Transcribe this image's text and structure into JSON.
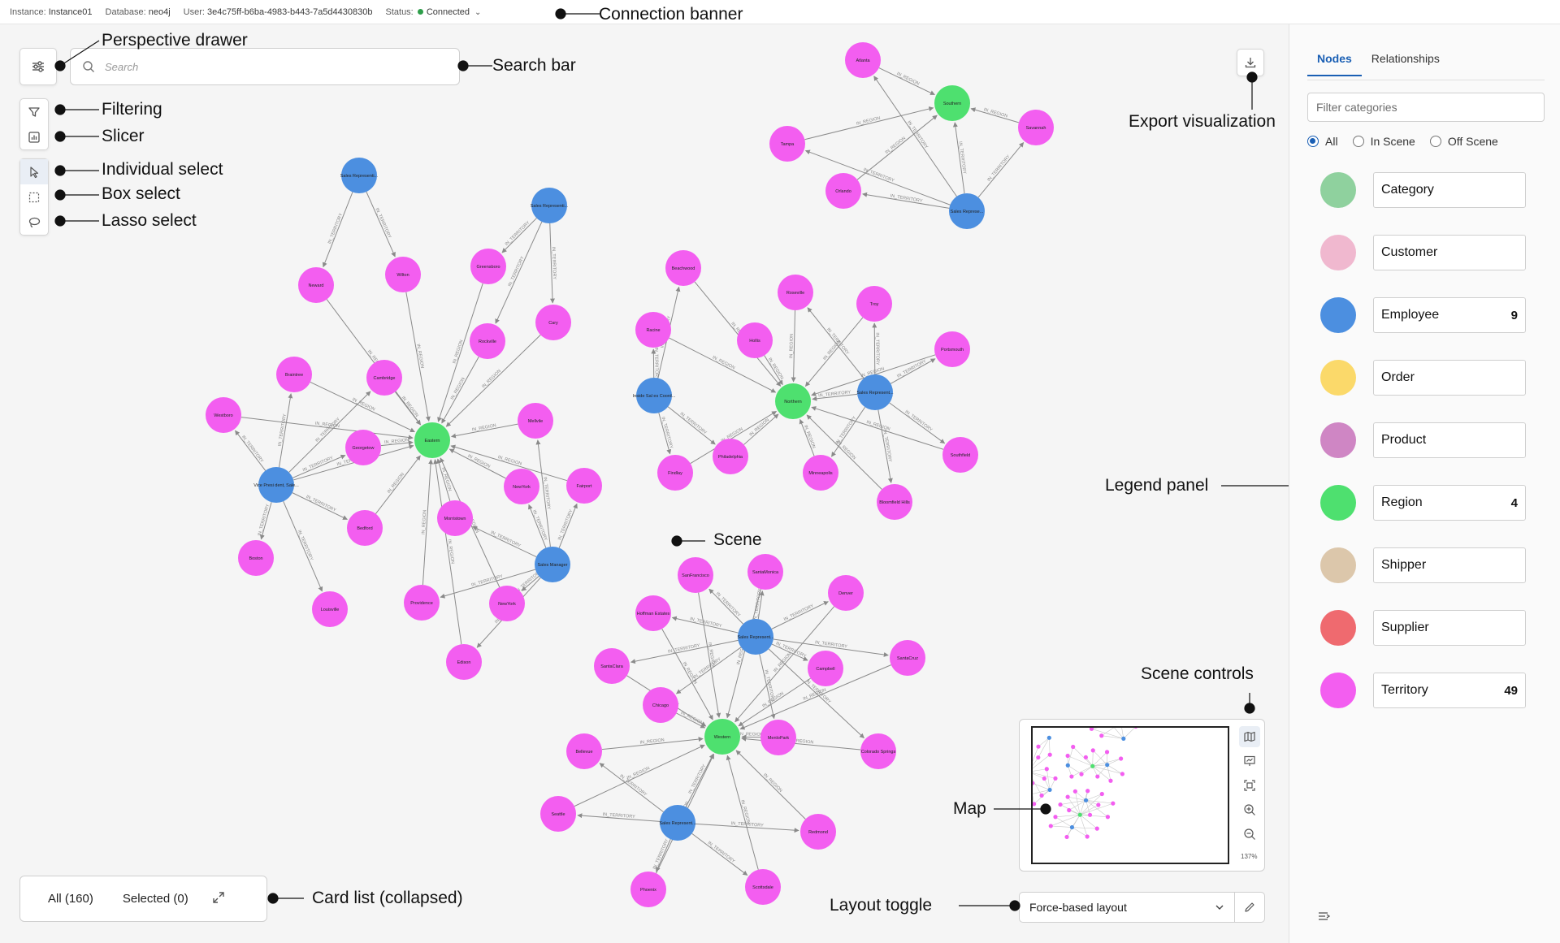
{
  "connection": {
    "instance_key": "Instance:",
    "instance_val": "Instance01",
    "database_key": "Database:",
    "database_val": "neo4j",
    "user_key": "User:",
    "user_val": "3e4c75ff-b6ba-4983-b443-7a5d4430830b",
    "status_key": "Status:",
    "status_val": "Connected",
    "status_color": "#2e9e4a"
  },
  "search": {
    "placeholder": "Search"
  },
  "callouts": {
    "connection_banner": "Connection banner",
    "perspective_drawer": "Perspective drawer",
    "search_bar": "Search bar",
    "filtering": "Filtering",
    "slicer": "Slicer",
    "individual_select": "Individual select",
    "box_select": "Box select",
    "lasso_select": "Lasso select",
    "export_visualization": "Export visualization",
    "legend_panel": "Legend panel",
    "scene": "Scene",
    "scene_controls": "Scene controls",
    "map": "Map",
    "card_list": "Card list (collapsed)",
    "layout_toggle": "Layout toggle"
  },
  "card_list": {
    "all": "All (160)",
    "selected": "Selected (0)"
  },
  "layout": {
    "selected": "Force-based layout"
  },
  "minimap": {
    "zoom": "137%"
  },
  "side_panel": {
    "tabs": [
      "Nodes",
      "Relationships"
    ],
    "filter_placeholder": "Filter categories",
    "radios": [
      "All",
      "In Scene",
      "Off Scene"
    ],
    "legend": [
      {
        "label": "Category",
        "count": "",
        "color": "#8fd19e"
      },
      {
        "label": "Customer",
        "count": "",
        "color": "#f0b8cf"
      },
      {
        "label": "Employee",
        "count": "9",
        "color": "#4c8fe0"
      },
      {
        "label": "Order",
        "count": "",
        "color": "#fbd96a"
      },
      {
        "label": "Product",
        "count": "",
        "color": "#cf86c4"
      },
      {
        "label": "Region",
        "count": "4",
        "color": "#4ee06f"
      },
      {
        "label": "Shipper",
        "count": "",
        "color": "#dcc7ab"
      },
      {
        "label": "Supplier",
        "count": "",
        "color": "#ef6a6f"
      },
      {
        "label": "Territory",
        "count": "49",
        "color": "#f35ef0"
      }
    ]
  },
  "colors": {
    "territory": "#f35ef0",
    "employee": "#4c8fe0",
    "region": "#4ee06f",
    "edge": "#8a8a8a"
  },
  "graph": {
    "nodes": [
      {
        "id": "eastern",
        "label": "Eastern",
        "type": "region"
      },
      {
        "id": "sr1",
        "label": "Sales Representi...",
        "type": "employee"
      },
      {
        "id": "zr1",
        "label": "Sales Representi...",
        "type": "employee"
      },
      {
        "id": "vp",
        "label": "Vice Presi dent, Sale...",
        "type": "employee"
      },
      {
        "id": "smgr",
        "label": "Sales Manager",
        "type": "employee"
      },
      {
        "id": "newark",
        "label": "Neward",
        "type": "territory"
      },
      {
        "id": "wilton",
        "label": "Wilton",
        "type": "territory"
      },
      {
        "id": "greensboro",
        "label": "Greensboro",
        "type": "territory"
      },
      {
        "id": "cary",
        "label": "Cary",
        "type": "territory"
      },
      {
        "id": "rockville",
        "label": "Rockville",
        "type": "territory"
      },
      {
        "id": "braintree",
        "label": "Braintree",
        "type": "territory"
      },
      {
        "id": "cambridge",
        "label": "Cambridge",
        "type": "territory"
      },
      {
        "id": "westboro",
        "label": "Westboro",
        "type": "territory"
      },
      {
        "id": "georgetow",
        "label": "Georgetow",
        "type": "territory"
      },
      {
        "id": "mellvile",
        "label": "Mellvile",
        "type": "territory"
      },
      {
        "id": "newyork1",
        "label": "NewYork",
        "type": "territory"
      },
      {
        "id": "fairport",
        "label": "Fairport",
        "type": "territory"
      },
      {
        "id": "bedford",
        "label": "Bedford",
        "type": "territory"
      },
      {
        "id": "morristown",
        "label": "Morristown",
        "type": "territory"
      },
      {
        "id": "boston",
        "label": "Boston",
        "type": "territory"
      },
      {
        "id": "louisville",
        "label": "Louisville",
        "type": "territory"
      },
      {
        "id": "providence",
        "label": "Providence",
        "type": "territory"
      },
      {
        "id": "newyork2",
        "label": "NewYork",
        "type": "territory"
      },
      {
        "id": "edison",
        "label": "Edison",
        "type": "territory"
      },
      {
        "id": "southern",
        "label": "Southern",
        "type": "region"
      },
      {
        "id": "atlanta",
        "label": "Atlanta",
        "type": "territory"
      },
      {
        "id": "savannah",
        "label": "Savannah",
        "type": "territory"
      },
      {
        "id": "tampa",
        "label": "Tampa",
        "type": "territory"
      },
      {
        "id": "orlando",
        "label": "Orlando",
        "type": "territory"
      },
      {
        "id": "sr2",
        "label": "Sales Represe...",
        "type": "employee"
      },
      {
        "id": "northern",
        "label": "Northern",
        "type": "region"
      },
      {
        "id": "beachwood",
        "label": "Beachwood",
        "type": "territory"
      },
      {
        "id": "roseville",
        "label": "Roseville",
        "type": "territory"
      },
      {
        "id": "troy",
        "label": "Troy",
        "type": "territory"
      },
      {
        "id": "racine",
        "label": "Racine",
        "type": "territory"
      },
      {
        "id": "hollis",
        "label": "Hollis",
        "type": "territory"
      },
      {
        "id": "portsmouth",
        "label": "Portsmouth",
        "type": "territory"
      },
      {
        "id": "isc",
        "label": "Inside Sal es Coord...",
        "type": "employee"
      },
      {
        "id": "sr3",
        "label": "Sales Represent...",
        "type": "employee"
      },
      {
        "id": "southfield",
        "label": "Southfield",
        "type": "territory"
      },
      {
        "id": "findlay",
        "label": "Findlay",
        "type": "territory"
      },
      {
        "id": "philadelphia",
        "label": "Philadelphia",
        "type": "territory"
      },
      {
        "id": "minneapolis",
        "label": "Minneapolis",
        "type": "territory"
      },
      {
        "id": "bloomfield",
        "label": "Bloomfield Hills",
        "type": "territory"
      },
      {
        "id": "western",
        "label": "Western",
        "type": "region"
      },
      {
        "id": "sanfran",
        "label": "SanFrancisco",
        "type": "territory"
      },
      {
        "id": "santamonica",
        "label": "SantaMonica",
        "type": "territory"
      },
      {
        "id": "denver",
        "label": "Denver",
        "type": "territory"
      },
      {
        "id": "hoffman",
        "label": "Hoffman Estates",
        "type": "territory"
      },
      {
        "id": "sr4",
        "label": "Sales Represent...",
        "type": "employee"
      },
      {
        "id": "santaclara",
        "label": "SantaClara",
        "type": "territory"
      },
      {
        "id": "campbell",
        "label": "Campbell",
        "type": "territory"
      },
      {
        "id": "santacruz",
        "label": "SantaCruz",
        "type": "territory"
      },
      {
        "id": "chicago",
        "label": "Chicago",
        "type": "territory"
      },
      {
        "id": "menlo",
        "label": "MenloPark",
        "type": "territory"
      },
      {
        "id": "bellevue",
        "label": "Bellevue",
        "type": "territory"
      },
      {
        "id": "colorado",
        "label": "Colorado Springs",
        "type": "territory"
      },
      {
        "id": "seattle",
        "label": "Seattle",
        "type": "territory"
      },
      {
        "id": "sr5",
        "label": "Sales Represent...",
        "type": "employee"
      },
      {
        "id": "redmond",
        "label": "Redmond",
        "type": "territory"
      },
      {
        "id": "phoenix",
        "label": "Phoenix",
        "type": "territory"
      },
      {
        "id": "scottsdale",
        "label": "Scottsdale",
        "type": "territory"
      }
    ],
    "edges": [
      {
        "from": "sr1",
        "to": "newark",
        "label": "IN_TERRITORY"
      },
      {
        "from": "sr1",
        "to": "wilton",
        "label": "IN_TERRITORY"
      },
      {
        "from": "zr1",
        "to": "greensboro",
        "label": "IN_TERRITORY"
      },
      {
        "from": "zr1",
        "to": "cary",
        "label": "IN_TERRITORY"
      },
      {
        "from": "zr1",
        "to": "rockville",
        "label": "IN_TERRITORY"
      },
      {
        "from": "newark",
        "to": "eastern",
        "label": "IN_REGION"
      },
      {
        "from": "wilton",
        "to": "eastern",
        "label": "IN_REGION"
      },
      {
        "from": "greensboro",
        "to": "eastern",
        "label": "IN_REGION"
      },
      {
        "from": "cary",
        "to": "eastern",
        "label": "IN_REGION"
      },
      {
        "from": "rockville",
        "to": "eastern",
        "label": "IN_REGION"
      },
      {
        "from": "braintree",
        "to": "eastern",
        "label": "IN_REGION"
      },
      {
        "from": "cambridge",
        "to": "eastern",
        "label": "IN_REGION"
      },
      {
        "from": "westboro",
        "to": "eastern",
        "label": "IN_REGION"
      },
      {
        "from": "georgetow",
        "to": "eastern",
        "label": "IN_REGION"
      },
      {
        "from": "mellvile",
        "to": "eastern",
        "label": "IN_REGION"
      },
      {
        "from": "newyork1",
        "to": "eastern",
        "label": "IN_REGION"
      },
      {
        "from": "fairport",
        "to": "eastern",
        "label": "IN_REGION"
      },
      {
        "from": "bedford",
        "to": "eastern",
        "label": "IN_REGION"
      },
      {
        "from": "morristown",
        "to": "eastern",
        "label": "IN_REGION"
      },
      {
        "from": "providence",
        "to": "eastern",
        "label": "IN_REGION"
      },
      {
        "from": "newyork2",
        "to": "eastern",
        "label": "IN_REGION"
      },
      {
        "from": "edison",
        "to": "eastern",
        "label": "IN_REGION"
      },
      {
        "from": "vp",
        "to": "braintree",
        "label": "IN_TERRITORY"
      },
      {
        "from": "vp",
        "to": "cambridge",
        "label": "IN_TERRITORY"
      },
      {
        "from": "vp",
        "to": "westboro",
        "label": "IN_TERRITORY"
      },
      {
        "from": "vp",
        "to": "georgetow",
        "label": "IN_TERRITORY"
      },
      {
        "from": "vp",
        "to": "bedford",
        "label": "IN_TERRITORY"
      },
      {
        "from": "vp",
        "to": "boston",
        "label": "IN_TERRITORY"
      },
      {
        "from": "vp",
        "to": "louisville",
        "label": "IN_TERRITORY"
      },
      {
        "from": "vp",
        "to": "eastern",
        "label": "IN_TERRITORY"
      },
      {
        "from": "smgr",
        "to": "newyork1",
        "label": "IN_TERRITORY"
      },
      {
        "from": "smgr",
        "to": "fairport",
        "label": "IN_TERRITORY"
      },
      {
        "from": "smgr",
        "to": "morristown",
        "label": "IN_TERRITORY"
      },
      {
        "from": "smgr",
        "to": "providence",
        "label": "IN_TERRITORY"
      },
      {
        "from": "smgr",
        "to": "newyork2",
        "label": "IN_TERRITORY"
      },
      {
        "from": "smgr",
        "to": "edison",
        "label": "IN_TERRITORY"
      },
      {
        "from": "smgr",
        "to": "mellvile",
        "label": "IN_TERRITORY"
      },
      {
        "from": "atlanta",
        "to": "southern",
        "label": "IN_REGION"
      },
      {
        "from": "savannah",
        "to": "southern",
        "label": "IN_REGION"
      },
      {
        "from": "tampa",
        "to": "southern",
        "label": "IN_REGION"
      },
      {
        "from": "orlando",
        "to": "southern",
        "label": "IN_REGION"
      },
      {
        "from": "sr2",
        "to": "atlanta",
        "label": "IN_TERRITORY"
      },
      {
        "from": "sr2",
        "to": "savannah",
        "label": "IN_TERRITORY"
      },
      {
        "from": "sr2",
        "to": "tampa",
        "label": "IN_TERRITORY"
      },
      {
        "from": "sr2",
        "to": "orlando",
        "label": "IN_TERRITORY"
      },
      {
        "from": "sr2",
        "to": "southern",
        "label": "IN_TERRITORY"
      },
      {
        "from": "beachwood",
        "to": "northern",
        "label": "IN_REGION"
      },
      {
        "from": "roseville",
        "to": "northern",
        "label": "IN_REGION"
      },
      {
        "from": "troy",
        "to": "northern",
        "label": "IN_REGION"
      },
      {
        "from": "racine",
        "to": "northern",
        "label": "IN_REGION"
      },
      {
        "from": "hollis",
        "to": "northern",
        "label": "IN_REGION"
      },
      {
        "from": "portsmouth",
        "to": "northern",
        "label": "IN_REGION"
      },
      {
        "from": "southfield",
        "to": "northern",
        "label": "IN_REGION"
      },
      {
        "from": "findlay",
        "to": "northern",
        "label": "IN_REGION"
      },
      {
        "from": "philadelphia",
        "to": "northern",
        "label": "IN_REGION"
      },
      {
        "from": "minneapolis",
        "to": "northern",
        "label": "IN_REGION"
      },
      {
        "from": "bloomfield",
        "to": "northern",
        "label": "IN_REGION"
      },
      {
        "from": "isc",
        "to": "beachwood",
        "label": "IN_TERRITORY"
      },
      {
        "from": "isc",
        "to": "racine",
        "label": "IN_TERRITORY"
      },
      {
        "from": "isc",
        "to": "findlay",
        "label": "IN_TERRITORY"
      },
      {
        "from": "isc",
        "to": "philadelphia",
        "label": "IN_TERRITORY"
      },
      {
        "from": "sr3",
        "to": "roseville",
        "label": "IN_TERRITORY"
      },
      {
        "from": "sr3",
        "to": "troy",
        "label": "IN_TERRITORY"
      },
      {
        "from": "sr3",
        "to": "portsmouth",
        "label": "IN_TERRITORY"
      },
      {
        "from": "sr3",
        "to": "southfield",
        "label": "IN_TERRITORY"
      },
      {
        "from": "sr3",
        "to": "bloomfield",
        "label": "IN_TERRITORY"
      },
      {
        "from": "sr3",
        "to": "minneapolis",
        "label": "IN_TERRITORY"
      },
      {
        "from": "sr3",
        "to": "northern",
        "label": "IN_TERRITORY"
      },
      {
        "from": "sanfran",
        "to": "western",
        "label": "IN_REGION"
      },
      {
        "from": "santamonica",
        "to": "western",
        "label": "IN_REGION"
      },
      {
        "from": "denver",
        "to": "western",
        "label": "IN_REGION"
      },
      {
        "from": "hoffman",
        "to": "western",
        "label": "IN_REGION"
      },
      {
        "from": "santaclara",
        "to": "western",
        "label": "IN_REGION"
      },
      {
        "from": "campbell",
        "to": "western",
        "label": "IN_REGION"
      },
      {
        "from": "santacruz",
        "to": "western",
        "label": "IN_REGION"
      },
      {
        "from": "chicago",
        "to": "western",
        "label": "IN_REGION"
      },
      {
        "from": "menlo",
        "to": "western",
        "label": "IN_REGION"
      },
      {
        "from": "bellevue",
        "to": "western",
        "label": "IN_REGION"
      },
      {
        "from": "colorado",
        "to": "western",
        "label": "IN_REGION"
      },
      {
        "from": "seattle",
        "to": "western",
        "label": "IN_REGION"
      },
      {
        "from": "redmond",
        "to": "western",
        "label": "IN_REGION"
      },
      {
        "from": "phoenix",
        "to": "western",
        "label": "IN_REGION"
      },
      {
        "from": "scottsdale",
        "to": "western",
        "label": "IN_REGION"
      },
      {
        "from": "sr4",
        "to": "sanfran",
        "label": "IN_TERRITORY"
      },
      {
        "from": "sr4",
        "to": "santamonica",
        "label": "IN_TERRITORY"
      },
      {
        "from": "sr4",
        "to": "denver",
        "label": "IN_TERRITORY"
      },
      {
        "from": "sr4",
        "to": "hoffman",
        "label": "IN_TERRITORY"
      },
      {
        "from": "sr4",
        "to": "santaclara",
        "label": "IN_TERRITORY"
      },
      {
        "from": "sr4",
        "to": "campbell",
        "label": "IN_TERRITORY"
      },
      {
        "from": "sr4",
        "to": "santacruz",
        "label": "IN_TERRITORY"
      },
      {
        "from": "sr4",
        "to": "chicago",
        "label": "IN_TERRITORY"
      },
      {
        "from": "sr4",
        "to": "menlo",
        "label": "IN_TERRITORY"
      },
      {
        "from": "sr4",
        "to": "colorado",
        "label": "IN_TERRITORY"
      },
      {
        "from": "sr5",
        "to": "seattle",
        "label": "IN_TERRITORY"
      },
      {
        "from": "sr5",
        "to": "redmond",
        "label": "IN_TERRITORY"
      },
      {
        "from": "sr5",
        "to": "phoenix",
        "label": "IN_TERRITORY"
      },
      {
        "from": "sr5",
        "to": "scottsdale",
        "label": "IN_TERRITORY"
      },
      {
        "from": "sr5",
        "to": "bellevue",
        "label": "IN_TERRITORY"
      },
      {
        "from": "sr5",
        "to": "western",
        "label": "IN_TERRITORY"
      }
    ]
  }
}
